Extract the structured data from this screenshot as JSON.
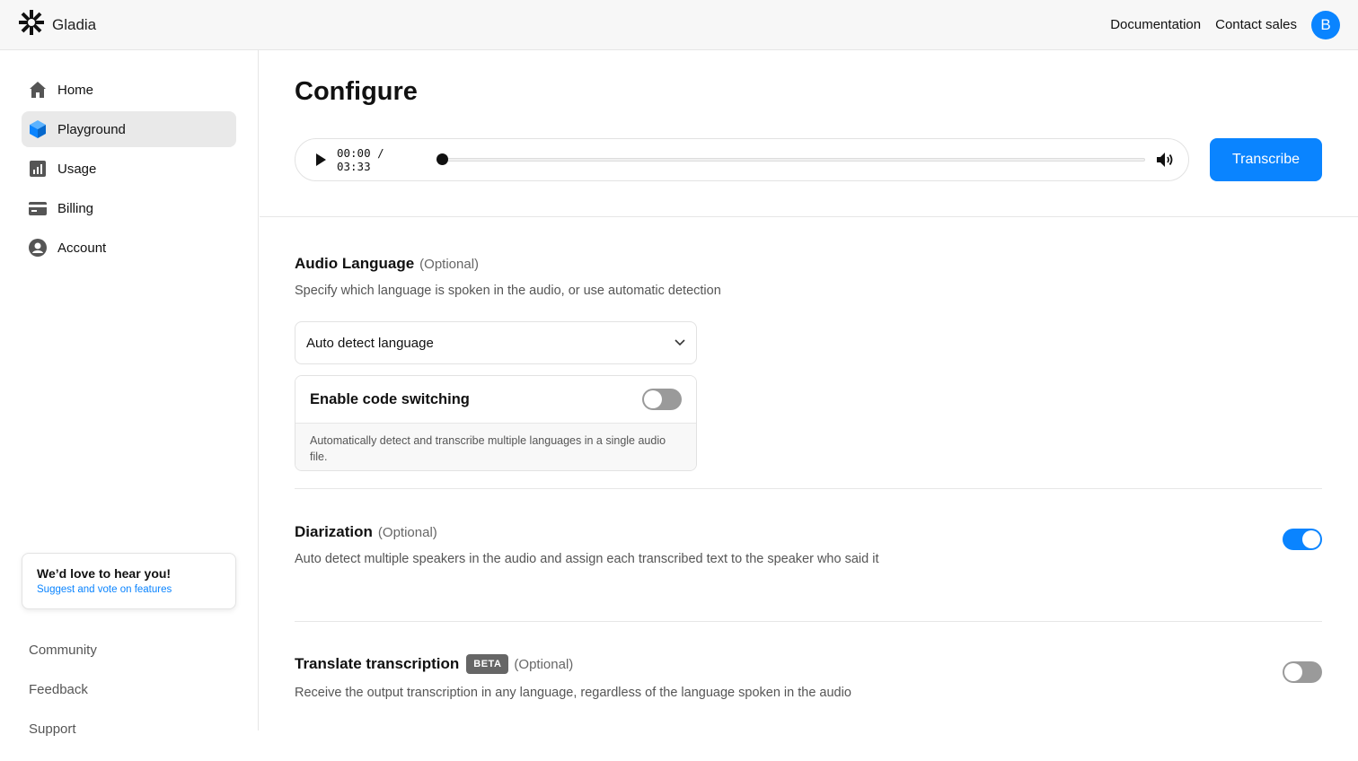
{
  "header": {
    "brand": "Gladia",
    "links": [
      "Documentation",
      "Contact sales"
    ],
    "avatar_initial": "B"
  },
  "sidebar": {
    "items": [
      {
        "label": "Home",
        "icon": "home-icon"
      },
      {
        "label": "Playground",
        "icon": "cube-icon",
        "active": true
      },
      {
        "label": "Usage",
        "icon": "bar-chart-icon"
      },
      {
        "label": "Billing",
        "icon": "credit-card-icon"
      },
      {
        "label": "Account",
        "icon": "user-circle-icon"
      }
    ],
    "feedback": {
      "title": "We’d love to hear you!",
      "link": "Suggest and vote on features"
    },
    "footer_links": [
      "Community",
      "Feedback",
      "Support"
    ]
  },
  "main": {
    "title": "Configure",
    "player": {
      "current_time": "00:00",
      "separator": "/",
      "duration": "03:33",
      "progress": 0
    },
    "transcribe_label": "Transcribe",
    "audio_language": {
      "title": "Audio Language",
      "optional": "(Optional)",
      "description": "Specify which language is spoken in the audio, or use automatic detection",
      "selected": "Auto detect language",
      "code_switching": {
        "title": "Enable code switching",
        "enabled": false,
        "description": "Automatically detect and transcribe multiple languages in a single audio file."
      }
    },
    "diarization": {
      "title": "Diarization",
      "optional": "(Optional)",
      "description": "Auto detect multiple speakers in the audio and assign each transcribed text to the speaker who said it",
      "enabled": true
    },
    "translate": {
      "title": "Translate transcription",
      "badge": "BETA",
      "optional": "(Optional)",
      "description": "Receive the output transcription in any language, regardless of the language spoken in the audio",
      "enabled": false
    }
  },
  "colors": {
    "accent": "#0a84ff",
    "toggle_off": "#9a9a9a",
    "active_nav_bg": "#e9e9e9"
  }
}
